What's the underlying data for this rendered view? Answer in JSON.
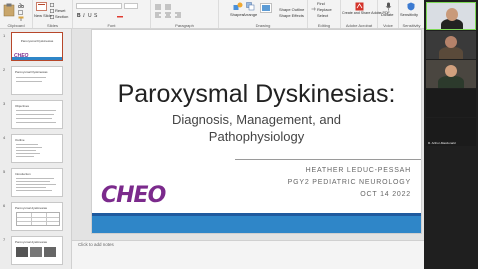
{
  "ribbon": {
    "groups": [
      {
        "label": "Clipboard"
      },
      {
        "label": "Slides"
      },
      {
        "label": "Font"
      },
      {
        "label": "Paragraph"
      },
      {
        "label": "Drawing"
      },
      {
        "label": "Editing"
      },
      {
        "label": "Adobe Acrobat"
      },
      {
        "label": "Voice"
      },
      {
        "label": "Sensitivity"
      }
    ],
    "new_slide": "New Slide",
    "reset": "Reset",
    "section": "Section",
    "shapes": "Shapes",
    "arrange": "Arrange",
    "shape_outline": "Shape Outline",
    "shape_effects": "Shape Effects",
    "find": "Find",
    "replace": "Replace",
    "select": "Select",
    "create_share_pdf": "Create and Share Adobe PDF",
    "dictate": "Dictate",
    "sensitivity": "Sensitivity"
  },
  "thumbnails": [
    {
      "num": "1",
      "title": "Paroxysmal Dyskinesias"
    },
    {
      "num": "2",
      "title": "Paroxysmal Dyskinesias"
    },
    {
      "num": "3",
      "title": "Objectives"
    },
    {
      "num": "4",
      "title": "Outline"
    },
    {
      "num": "5",
      "title": "Introduction"
    },
    {
      "num": "6",
      "title": "Paroxysmal dyskinesias"
    },
    {
      "num": "7",
      "title": "Paroxysmal dyskinesias"
    }
  ],
  "slide": {
    "title": "Paroxysmal Dyskinesias:",
    "subtitle_line1": "Diagnosis, Management, and",
    "subtitle_line2": "Pathophysiology",
    "logo": "CHEO",
    "author": "HEATHER LEDUC-PESSAH",
    "role": "PGY2 PEDIATRIC NEUROLOGY",
    "date": "OCT 14 2022"
  },
  "notes_placeholder": "Click to add notes",
  "video": {
    "participants": [
      {
        "name": ""
      },
      {
        "name": ""
      },
      {
        "name": ""
      },
      {
        "name": ""
      },
      {
        "name": "R. Arthur-Macdonald"
      }
    ]
  }
}
